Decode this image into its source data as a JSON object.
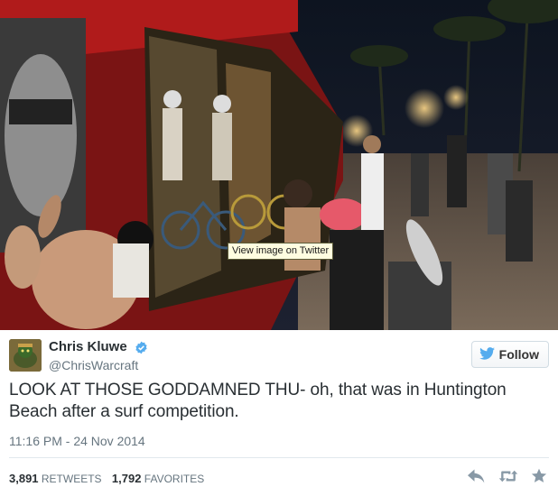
{
  "media": {
    "tooltip": "View image on Twitter"
  },
  "author": {
    "display_name": "Chris Kluwe",
    "screen_name": "@ChrisWarcraft",
    "verified": true
  },
  "follow_button": {
    "label": "Follow"
  },
  "tweet": {
    "text": "LOOK AT THOSE GODDAMNED THU- oh, that was in Huntington Beach after a surf competition.",
    "timestamp": "11:16 PM - 24 Nov 2014"
  },
  "stats": {
    "retweets_count": "3,891",
    "retweets_label": "Retweets",
    "favorites_count": "1,792",
    "favorites_label": "Favorites"
  },
  "icons": {
    "reply": "reply-icon",
    "retweet": "retweet-icon",
    "favorite": "star-icon",
    "follow": "twitter-bird-icon",
    "verified": "verified-check-icon"
  },
  "colors": {
    "accent_blue": "#55acee",
    "text_primary": "#292f33",
    "text_secondary": "#66757f",
    "divider": "#e1e8ed"
  }
}
